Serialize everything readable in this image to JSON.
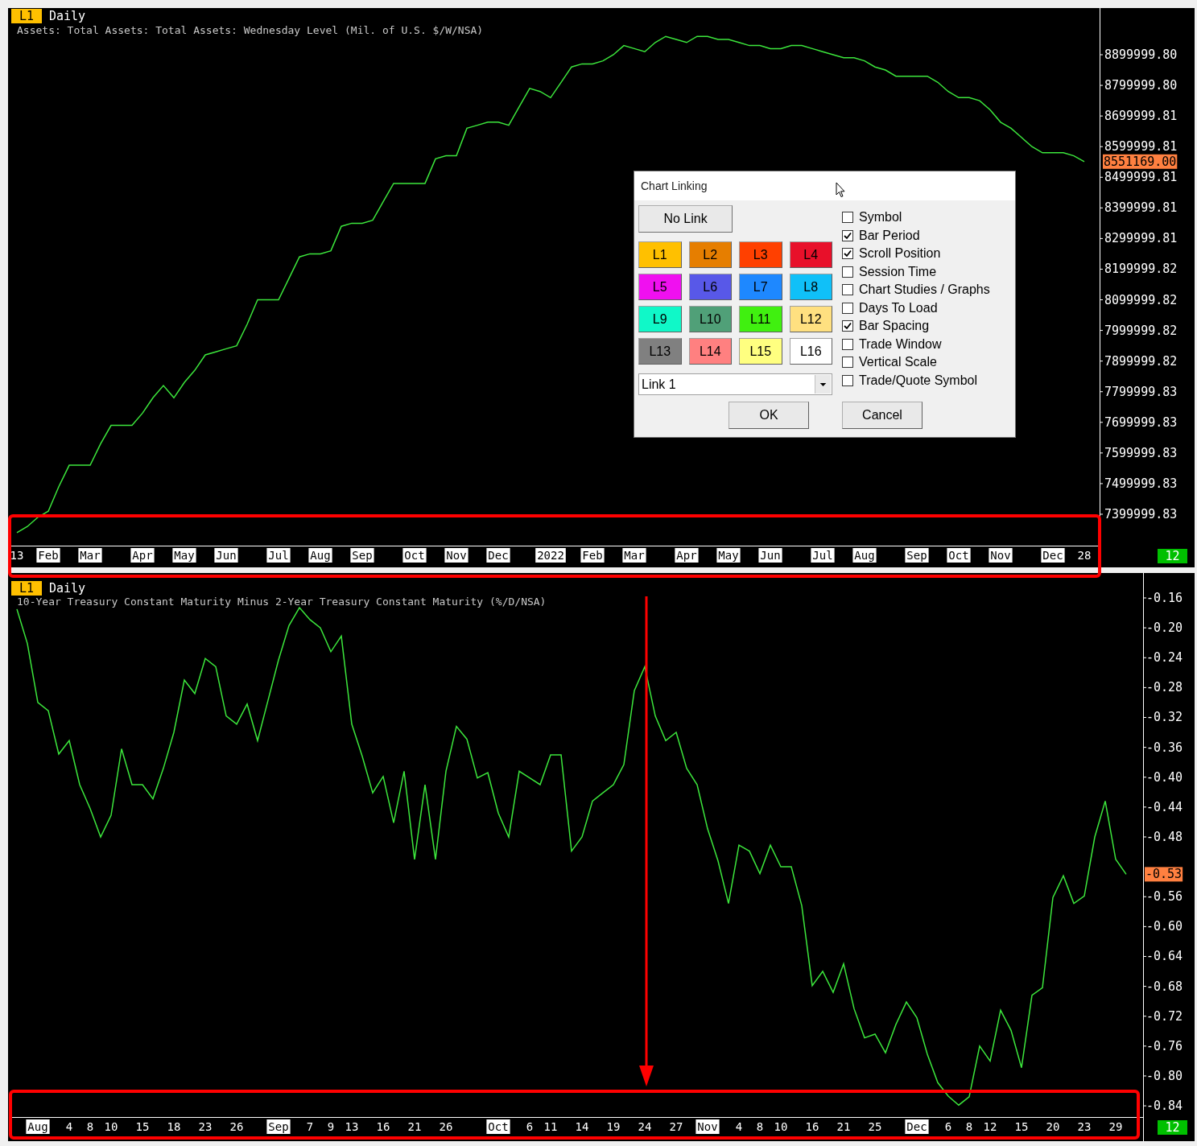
{
  "charts": [
    {
      "badge": "L1",
      "period": "Daily",
      "subtitle": "Assets: Total Assets: Total Assets: Wednesday Level (Mil. of U.S. $/W/NSA)",
      "last_value": "8551169.00",
      "bar_count": "12",
      "xtick_boxed": [
        false,
        true,
        true,
        true,
        true,
        true,
        true,
        true,
        true,
        true,
        true,
        true,
        true,
        true,
        true,
        true,
        true,
        true,
        true,
        true,
        true,
        true,
        true,
        true,
        false
      ],
      "chart_data": {
        "type": "line",
        "ylim": [
          7297500,
          9052400
        ],
        "categories": [
          "13",
          null,
          null,
          "Feb",
          null,
          null,
          null,
          "Mar",
          null,
          null,
          null,
          null,
          "Apr",
          null,
          null,
          null,
          "May",
          null,
          null,
          null,
          "Jun",
          null,
          null,
          null,
          null,
          "Jul",
          null,
          null,
          null,
          "Aug",
          null,
          null,
          null,
          "Sep",
          null,
          null,
          null,
          null,
          "Oct",
          null,
          null,
          null,
          "Nov",
          null,
          null,
          null,
          "Dec",
          null,
          null,
          null,
          null,
          "2022",
          null,
          null,
          null,
          "Feb",
          null,
          null,
          null,
          "Mar",
          null,
          null,
          null,
          null,
          "Apr",
          null,
          null,
          null,
          "May",
          null,
          null,
          null,
          "Jun",
          null,
          null,
          null,
          null,
          "Jul",
          null,
          null,
          null,
          "Aug",
          null,
          null,
          null,
          null,
          "Sep",
          null,
          null,
          null,
          "Oct",
          null,
          null,
          null,
          "Nov",
          null,
          null,
          null,
          null,
          "Dec",
          null,
          null,
          "28"
        ],
        "series": [
          {
            "color": "#3ce63c",
            "values": [
              7340000,
              7360000,
              7390000,
              7410000,
              7490000,
              7560000,
              7560000,
              7560000,
              7630000,
              7690000,
              7690000,
              7690000,
              7730000,
              7780000,
              7820000,
              7780000,
              7830000,
              7870000,
              7920000,
              7930000,
              7940000,
              7950000,
              8020000,
              8100000,
              8100000,
              8100000,
              8170000,
              8240000,
              8250000,
              8250000,
              8260000,
              8340000,
              8350000,
              8350000,
              8360000,
              8420000,
              8480000,
              8480000,
              8480000,
              8480000,
              8560000,
              8570000,
              8570000,
              8660000,
              8670000,
              8680000,
              8680000,
              8670000,
              8730000,
              8790000,
              8780000,
              8760000,
              8810000,
              8860000,
              8870000,
              8870000,
              8880000,
              8900000,
              8930000,
              8920000,
              8910000,
              8940000,
              8960000,
              8950000,
              8940000,
              8960000,
              8960000,
              8950000,
              8950000,
              8940000,
              8930000,
              8930000,
              8920000,
              8920000,
              8930000,
              8930000,
              8920000,
              8910000,
              8900000,
              8890000,
              8890000,
              8880000,
              8860000,
              8850000,
              8830000,
              8830000,
              8830000,
              8830000,
              8810000,
              8780000,
              8760000,
              8760000,
              8750000,
              8720000,
              8680000,
              8660000,
              8630000,
              8600000,
              8580000,
              8580000,
              8580000,
              8570000,
              8551169
            ]
          }
        ],
        "yticks": [
          {
            "value": 8899999.8,
            "label": "8899999.80"
          },
          {
            "value": 8799999.8,
            "label": "8799999.80"
          },
          {
            "value": 8699999.81,
            "label": "8699999.81"
          },
          {
            "value": 8599999.81,
            "label": "8599999.81"
          },
          {
            "value": 8499999.81,
            "label": "8499999.81"
          },
          {
            "value": 8399999.81,
            "label": "8399999.81"
          },
          {
            "value": 8299999.81,
            "label": "8299999.81"
          },
          {
            "value": 8199999.82,
            "label": "8199999.82"
          },
          {
            "value": 8099999.82,
            "label": "8099999.82"
          },
          {
            "value": 7999999.82,
            "label": "7999999.82"
          },
          {
            "value": 7899999.82,
            "label": "7899999.82"
          },
          {
            "value": 7799999.83,
            "label": "7799999.83"
          },
          {
            "value": 7699999.83,
            "label": "7699999.83"
          },
          {
            "value": 7599999.83,
            "label": "7599999.83"
          },
          {
            "value": 7499999.83,
            "label": "7499999.83"
          },
          {
            "value": 7399999.83,
            "label": "7399999.83"
          }
        ]
      }
    },
    {
      "badge": "L1",
      "period": "Daily",
      "subtitle": "10-Year Treasury Constant Maturity Minus 2-Year Treasury Constant Maturity (%/D/NSA)",
      "last_value": "-0.53",
      "bar_count": "12",
      "xtick_boxed": [
        true,
        false,
        false,
        false,
        false,
        false,
        false,
        false,
        true,
        false,
        false,
        false,
        false,
        false,
        false,
        true,
        false,
        false,
        false,
        false,
        false,
        false,
        true,
        false,
        false,
        false,
        false,
        false,
        false,
        true,
        false,
        false,
        false,
        false,
        false,
        false,
        false
      ],
      "chart_data": {
        "type": "line",
        "ylim": [
          -0.855,
          -0.1266
        ],
        "categories": [
          null,
          null,
          "Aug",
          null,
          null,
          "4",
          null,
          "8",
          null,
          "10",
          null,
          null,
          "15",
          null,
          null,
          "18",
          null,
          null,
          "23",
          null,
          null,
          "26",
          null,
          null,
          null,
          "Sep",
          null,
          null,
          "7",
          null,
          "9",
          null,
          "13",
          null,
          null,
          "16",
          null,
          null,
          "21",
          null,
          null,
          "26",
          null,
          null,
          null,
          null,
          "Oct",
          null,
          null,
          "6",
          null,
          "11",
          null,
          null,
          "14",
          null,
          null,
          "19",
          null,
          null,
          "24",
          null,
          null,
          "27",
          null,
          null,
          "Nov",
          null,
          null,
          "4",
          null,
          "8",
          null,
          "10",
          null,
          null,
          "16",
          null,
          null,
          "21",
          null,
          null,
          "25",
          null,
          null,
          null,
          "Dec",
          null,
          null,
          "6",
          null,
          "8",
          null,
          "12",
          null,
          null,
          "15",
          null,
          null,
          "20",
          null,
          null,
          "23",
          null,
          null,
          "29",
          null
        ],
        "series": [
          {
            "color": "#3ce63c",
            "values": [
              -0.175,
              -0.221,
              -0.3,
              -0.311,
              -0.369,
              -0.351,
              -0.41,
              -0.442,
              -0.48,
              -0.451,
              -0.362,
              -0.41,
              -0.41,
              -0.429,
              -0.388,
              -0.34,
              -0.27,
              -0.288,
              -0.241,
              -0.252,
              -0.318,
              -0.329,
              -0.302,
              -0.351,
              -0.297,
              -0.243,
              -0.197,
              -0.173,
              -0.189,
              -0.2,
              -0.232,
              -0.211,
              -0.329,
              -0.372,
              -0.421,
              -0.399,
              -0.461,
              -0.392,
              -0.51,
              -0.41,
              -0.51,
              -0.392,
              -0.332,
              -0.349,
              -0.401,
              -0.394,
              -0.448,
              -0.48,
              -0.392,
              -0.401,
              -0.41,
              -0.37,
              -0.37,
              -0.499,
              -0.48,
              -0.432,
              -0.421,
              -0.41,
              -0.383,
              -0.284,
              -0.252,
              -0.318,
              -0.351,
              -0.34,
              -0.388,
              -0.41,
              -0.469,
              -0.512,
              -0.569,
              -0.491,
              -0.499,
              -0.529,
              -0.491,
              -0.52,
              -0.52,
              -0.572,
              -0.679,
              -0.66,
              -0.688,
              -0.65,
              -0.71,
              -0.749,
              -0.744,
              -0.769,
              -0.731,
              -0.701,
              -0.722,
              -0.771,
              -0.809,
              -0.827,
              -0.839,
              -0.828,
              -0.76,
              -0.78,
              -0.712,
              -0.739,
              -0.789,
              -0.692,
              -0.682,
              -0.561,
              -0.532,
              -0.569,
              -0.559,
              -0.48,
              -0.432,
              -0.51,
              -0.53
            ]
          }
        ],
        "yticks": [
          {
            "value": -0.16,
            "label": "-0.16"
          },
          {
            "value": -0.2,
            "label": "-0.20"
          },
          {
            "value": -0.24,
            "label": "-0.24"
          },
          {
            "value": -0.28,
            "label": "-0.28"
          },
          {
            "value": -0.32,
            "label": "-0.32"
          },
          {
            "value": -0.36,
            "label": "-0.36"
          },
          {
            "value": -0.4,
            "label": "-0.40"
          },
          {
            "value": -0.44,
            "label": "-0.44"
          },
          {
            "value": -0.48,
            "label": "-0.48"
          },
          {
            "value": -0.56,
            "label": "-0.56"
          },
          {
            "value": -0.6,
            "label": "-0.60"
          },
          {
            "value": -0.64,
            "label": "-0.64"
          },
          {
            "value": -0.68,
            "label": "-0.68"
          },
          {
            "value": -0.72,
            "label": "-0.72"
          },
          {
            "value": -0.76,
            "label": "-0.76"
          },
          {
            "value": -0.8,
            "label": "-0.80"
          },
          {
            "value": -0.84,
            "label": "-0.84"
          }
        ]
      }
    }
  ],
  "dialog": {
    "title": "Chart Linking",
    "no_link_button": "No Link",
    "link_buttons": [
      {
        "label": "L1",
        "color": "#ffc000"
      },
      {
        "label": "L2",
        "color": "#e67e00"
      },
      {
        "label": "L3",
        "color": "#ff4000"
      },
      {
        "label": "L4",
        "color": "#e8102a"
      },
      {
        "label": "L5",
        "color": "#f010f0"
      },
      {
        "label": "L6",
        "color": "#5858e8"
      },
      {
        "label": "L7",
        "color": "#1e88ff"
      },
      {
        "label": "L8",
        "color": "#10c0f8"
      },
      {
        "label": "L9",
        "color": "#10f8c8"
      },
      {
        "label": "L10",
        "color": "#50a078"
      },
      {
        "label": "L11",
        "color": "#40f010"
      },
      {
        "label": "L12",
        "color": "#ffe080"
      },
      {
        "label": "L13",
        "color": "#808080"
      },
      {
        "label": "L14",
        "color": "#ff8080"
      },
      {
        "label": "L15",
        "color": "#ffff80"
      },
      {
        "label": "L16",
        "color": "#ffffff"
      }
    ],
    "link_select": {
      "value": "Link 1"
    },
    "options": [
      {
        "label": "Symbol",
        "checked": false
      },
      {
        "label": "Bar Period",
        "checked": true
      },
      {
        "label": "Scroll Position",
        "checked": true
      },
      {
        "label": "Session Time",
        "checked": false
      },
      {
        "label": "Chart Studies / Graphs",
        "checked": false
      },
      {
        "label": "Days To Load",
        "checked": false
      },
      {
        "label": "Bar Spacing",
        "checked": true
      },
      {
        "label": "Trade Window",
        "checked": false
      },
      {
        "label": "Vertical Scale",
        "checked": false
      },
      {
        "label": "Trade/Quote Symbol",
        "checked": false
      }
    ],
    "buttons": [
      "OK",
      "Cancel"
    ]
  }
}
